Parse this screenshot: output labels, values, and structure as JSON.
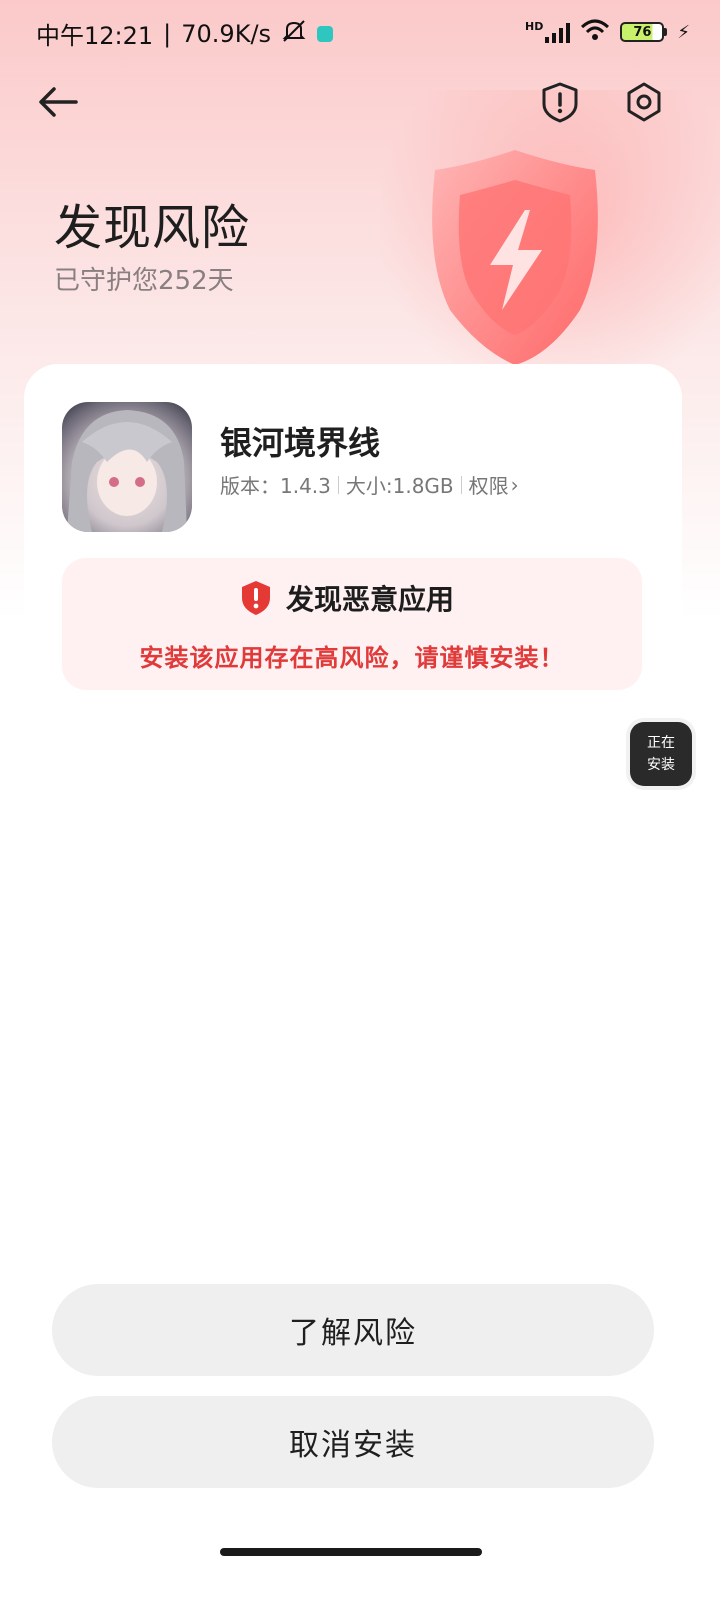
{
  "status_bar": {
    "time": "中午12:21",
    "speed": "70.9K/s",
    "network": "HD",
    "battery": "76"
  },
  "hero": {
    "title": "发现风险",
    "subtitle": "已守护您252天"
  },
  "app": {
    "name": "银河境界线",
    "version": "版本：1.4.3",
    "size": "大小:1.8GB",
    "permissions_label": "权限",
    "permissions_arrow": "›"
  },
  "warning": {
    "title": "发现恶意应用",
    "message": "安装该应用存在高风险，请谨慎安装！"
  },
  "floating": {
    "line1": "正在",
    "line2": "安装"
  },
  "buttons": {
    "learn_risk": "了解风险",
    "cancel_install": "取消安装"
  },
  "colors": {
    "accent_red": "#e03a3a",
    "warning_bg": "#fff1f1",
    "button_bg": "#efefef"
  }
}
